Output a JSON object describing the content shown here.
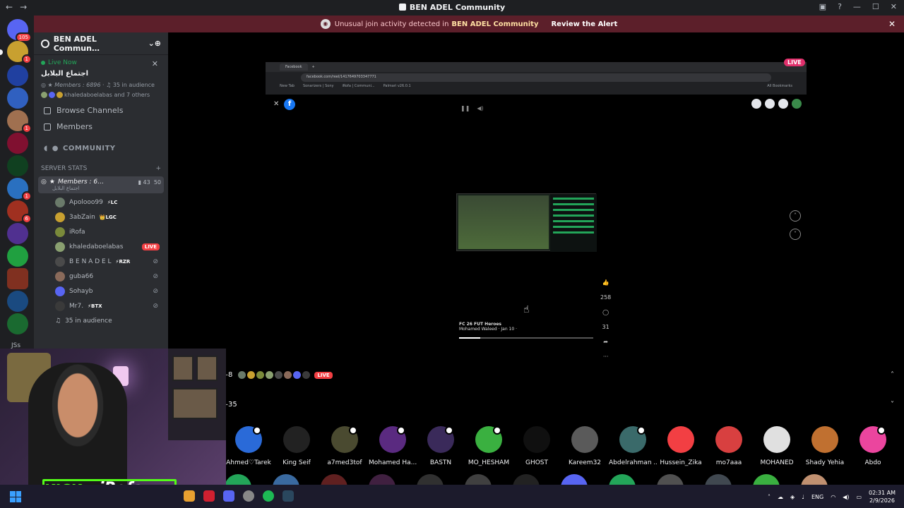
{
  "titlebar": {
    "title": "BEN ADEL Community",
    "back": "←",
    "forward": "→"
  },
  "banner": {
    "message_pre": "Unusual join activity detected in",
    "server": "BEN ADEL Community",
    "action": "Review the Alert",
    "close": "✕",
    "color": "#5c1f2a"
  },
  "guilds": {
    "badges": [
      "105",
      "1",
      "1",
      "1",
      "6"
    ],
    "jss_label": "JSs"
  },
  "sidebar": {
    "server_name": "BEN ADEL Commun…",
    "live_now": "Live Now",
    "live_title": "اجتماع البلابل",
    "members_line": "Members : 6896",
    "audience": "35 in audience",
    "avatars_line": "khaledaboelabas and 7 others",
    "browse_channels": "Browse Channels",
    "members_nav": "Members",
    "community": "COMMUNITY",
    "category": "SERVER STATS",
    "voice_channel": "Members : 6…",
    "voice_sub": "اجتماع البلابل",
    "voice_count_a": "43",
    "voice_count_b": "50",
    "users": [
      {
        "name": "Apolooo99",
        "tag": "⚡LC",
        "color": "#6a7a6a"
      },
      {
        "name": "3abZain",
        "tag": "👑LGC",
        "color": "#c8a030"
      },
      {
        "name": "iRofa",
        "tag": "",
        "color": "#7a8a3a"
      },
      {
        "name": "khaledaboelabas",
        "tag": "",
        "color": "#8aa070",
        "live": "LIVE"
      },
      {
        "name": "B E N A D E L",
        "tag": "⚡RZR",
        "color": "#4a4a4a"
      },
      {
        "name": "guba66",
        "tag": "",
        "color": "#8a6a5a"
      },
      {
        "name": "Sohayb",
        "tag": "",
        "color": "#5865f2"
      },
      {
        "name": "Mr7.",
        "tag": "⚡BTX",
        "color": "#3a3a3a"
      }
    ],
    "audience_row": "35 in audience"
  },
  "stream": {
    "tab_label": "Facebook",
    "url": "facebook.com/reel/1417649703347771",
    "bookmarks": [
      "New Tab",
      "Sonarizers | Sony",
      "iRofa | Communi...",
      "Palmari v26.0.1"
    ],
    "all_bookmarks": "All Bookmarks",
    "live_chip": "LIVE",
    "reel_title": "FC 26 FUT Heroes",
    "reel_author": "Mohamed Waleed · Jan 10 · ",
    "reel_stats": [
      "258",
      "31"
    ],
    "more": "···"
  },
  "rows": {
    "live_count": "8",
    "live_badge": "LIVE",
    "audience_count": "35"
  },
  "members": [
    {
      "name": "Ahmed♡Tarek",
      "color": "#2a6ad8"
    },
    {
      "name": "King Seif",
      "color": "#222222"
    },
    {
      "name": "a7med3tof",
      "color": "#4a4a30"
    },
    {
      "name": "Mohamed Ha...",
      "color": "#5a2a80"
    },
    {
      "name": "BASTN",
      "color": "#3a2a5a"
    },
    {
      "name": "MO_HESHAM",
      "color": "#3ab040"
    },
    {
      "name": "GHOST",
      "color": "#101010"
    },
    {
      "name": "Kareem32",
      "color": "#5a5a5a"
    },
    {
      "name": "Abdelrahman ...",
      "color": "#3a6a6a"
    },
    {
      "name": "Hussein_Zika",
      "color": "#f23f43"
    },
    {
      "name": "mo7aaa",
      "color": "#d84040"
    },
    {
      "name": "MOHANED",
      "color": "#e0e0e0"
    },
    {
      "name": "Shady Yehia",
      "color": "#c07030"
    },
    {
      "name": "Abdo",
      "color": "#eb459e"
    }
  ],
  "overlay": {
    "kick": "KICK",
    "name": "iRofa"
  },
  "taskbar": {
    "lang": "ENG",
    "time": "02:31 AM",
    "date": "2/9/2026"
  }
}
